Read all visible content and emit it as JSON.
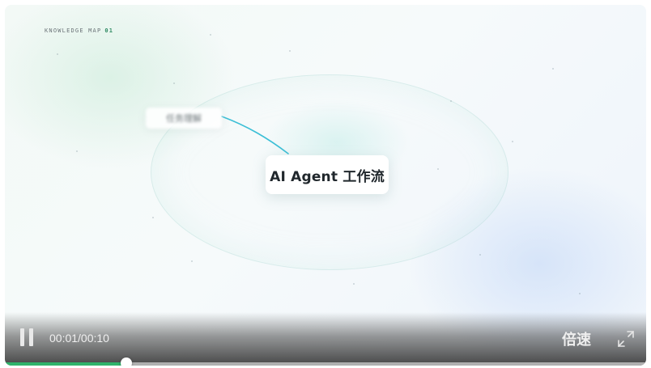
{
  "scene": {
    "map_label": "KNOWLEDGE MAP",
    "map_number": "01",
    "node_side": "任务理解",
    "node_main": "AI Agent 工作流"
  },
  "controls": {
    "pause_icon": "pause-icon",
    "time_text": "00:01/00:10",
    "speed_label": "倍速",
    "fullscreen_icon": "fullscreen-icon",
    "progress": 0.19,
    "accent_color": "#2fb36b"
  }
}
